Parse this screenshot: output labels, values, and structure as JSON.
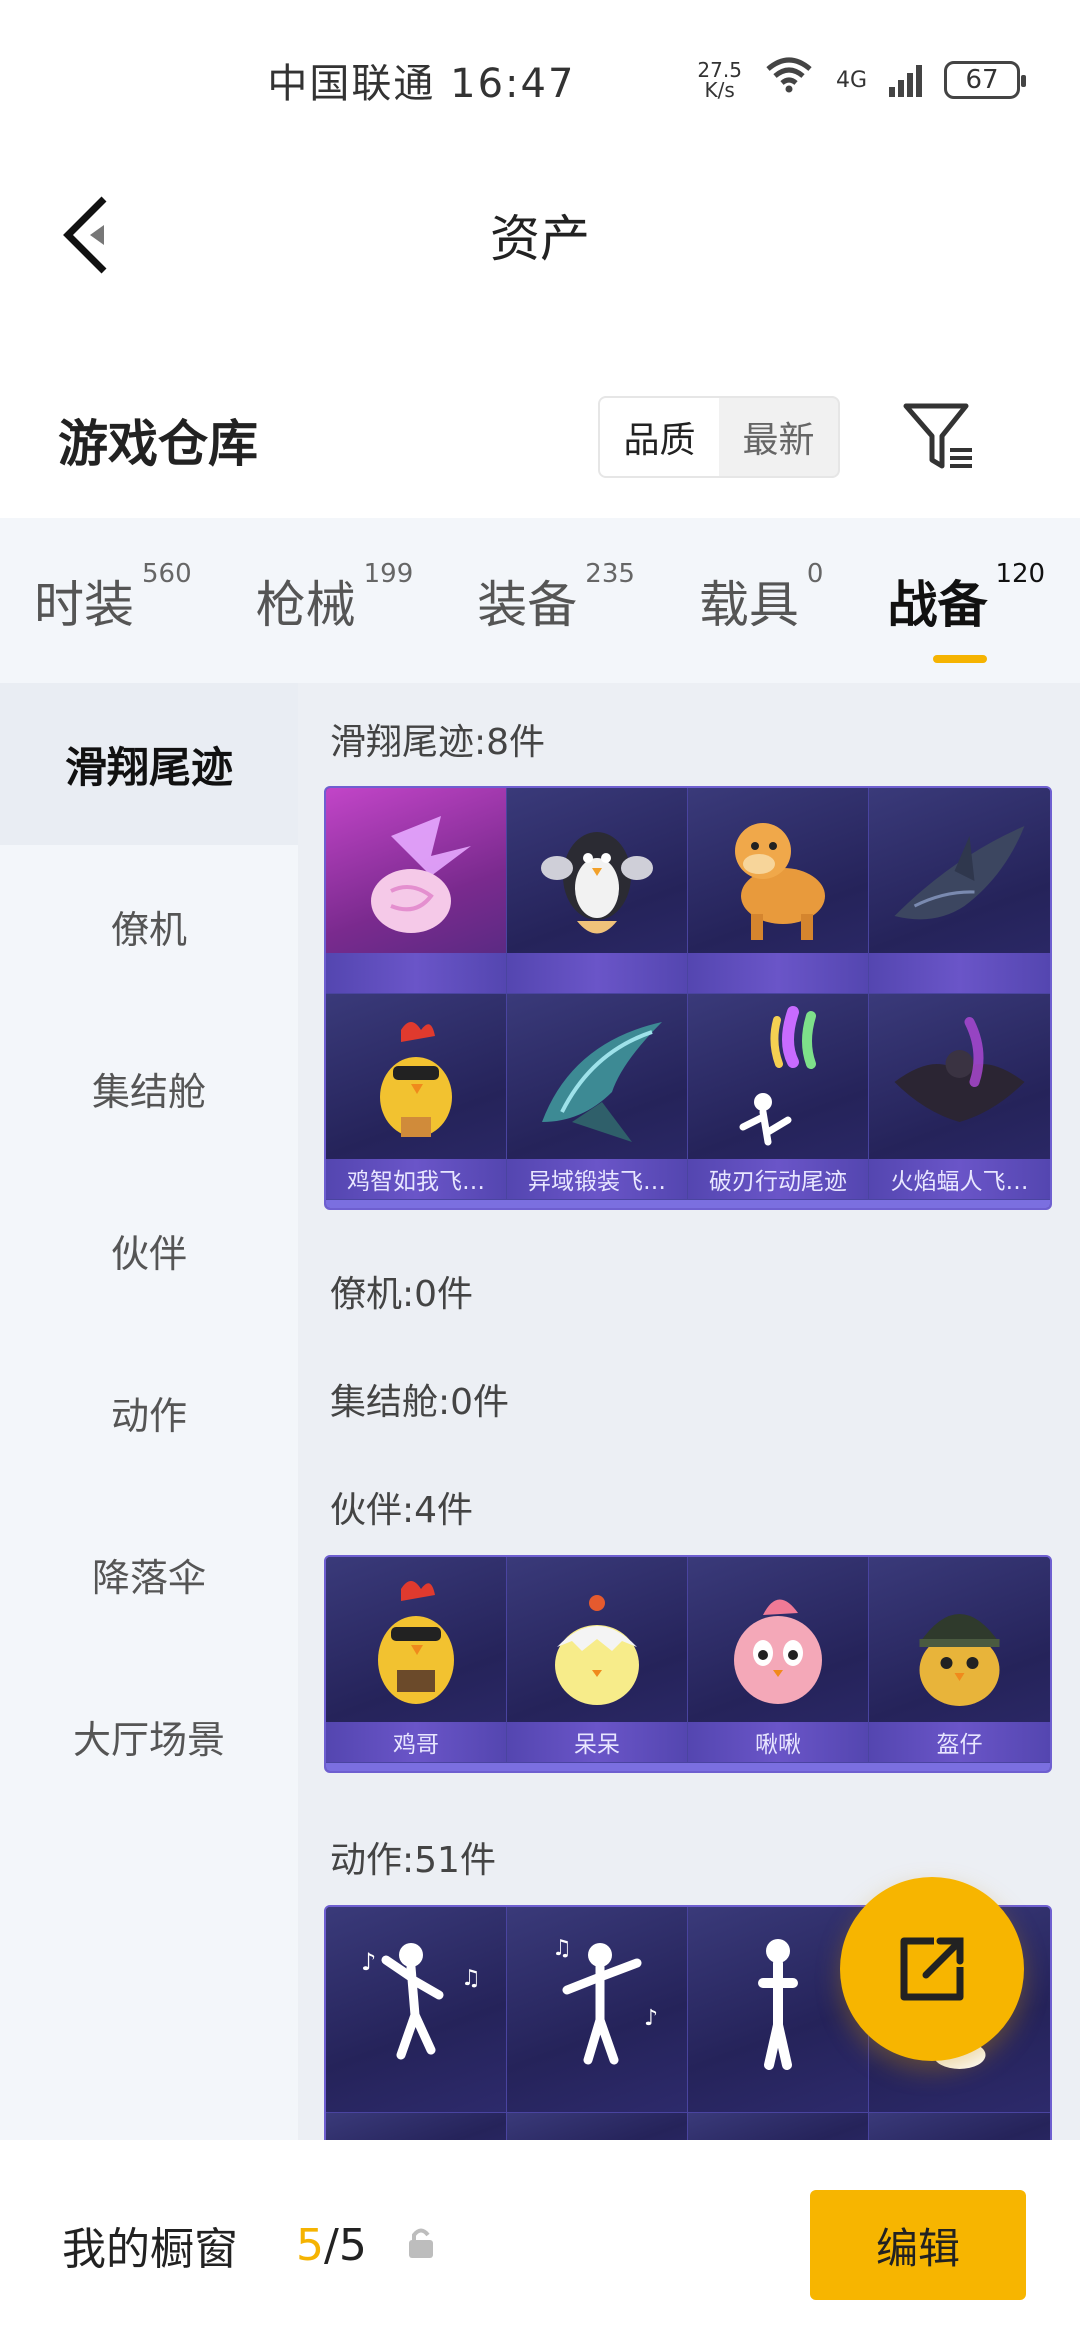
{
  "status_bar": {
    "carrier_time": "中国联通 16:47",
    "speed_value": "27.5",
    "speed_unit": "K/s",
    "network": "4G",
    "battery": "67"
  },
  "header": {
    "title": "资产",
    "back_icon": "chevron-left-icon"
  },
  "warehouse": {
    "title": "游戏仓库",
    "sort_options": [
      "品质",
      "最新"
    ],
    "selected_sort": "品质",
    "filter_icon": "filter-icon"
  },
  "category_tabs": [
    {
      "label": "时装",
      "count": "560"
    },
    {
      "label": "枪械",
      "count": "199"
    },
    {
      "label": "装备",
      "count": "235"
    },
    {
      "label": "载具",
      "count": "0"
    },
    {
      "label": "战备",
      "count": "120"
    }
  ],
  "active_tab": "战备",
  "side_menu": {
    "items": [
      "滑翔尾迹",
      "僚机",
      "集结舱",
      "伙伴",
      "动作",
      "降落伞",
      "大厅场景"
    ],
    "active": "滑翔尾迹"
  },
  "sections": {
    "glide_trail": {
      "label": "滑翔尾迹:8件",
      "items": [
        {
          "name": "",
          "art": "candy-wing"
        },
        {
          "name": "",
          "art": "penguin"
        },
        {
          "name": "",
          "art": "pony"
        },
        {
          "name": "",
          "art": "shark"
        },
        {
          "name": "鸡智如我飞…",
          "art": "chicken"
        },
        {
          "name": "异域锻装飞…",
          "art": "blade-wing"
        },
        {
          "name": "破刃行动尾迹",
          "art": "smoke-trail"
        },
        {
          "name": "火焰蝠人飞…",
          "art": "bat-suit"
        }
      ]
    },
    "wingman": {
      "label": "僚机:0件"
    },
    "pod": {
      "label": "集结舱:0件"
    },
    "companion": {
      "label": "伙伴:4件",
      "items": [
        {
          "name": "鸡哥",
          "art": "chicken"
        },
        {
          "name": "呆呆",
          "art": "chick-egg"
        },
        {
          "name": "啾啾",
          "art": "pink-bird"
        },
        {
          "name": "盔仔",
          "art": "helmet-chick"
        }
      ]
    },
    "emote": {
      "label": "动作:51件",
      "items": [
        {
          "name": "",
          "art": "dance-1"
        },
        {
          "name": "",
          "art": "dance-2"
        },
        {
          "name": "",
          "art": "pose-3"
        },
        {
          "name": "",
          "art": "pose-4"
        }
      ]
    }
  },
  "fab_icon": "share-icon",
  "bottom_bar": {
    "window_label": "我的橱窗",
    "current": "5",
    "total": "/5",
    "lock_icon": "lock-icon",
    "edit_label": "编辑"
  },
  "colors": {
    "accent": "#f7b500",
    "card_bg": "#2a2760",
    "card_label": "#6a55c8"
  }
}
